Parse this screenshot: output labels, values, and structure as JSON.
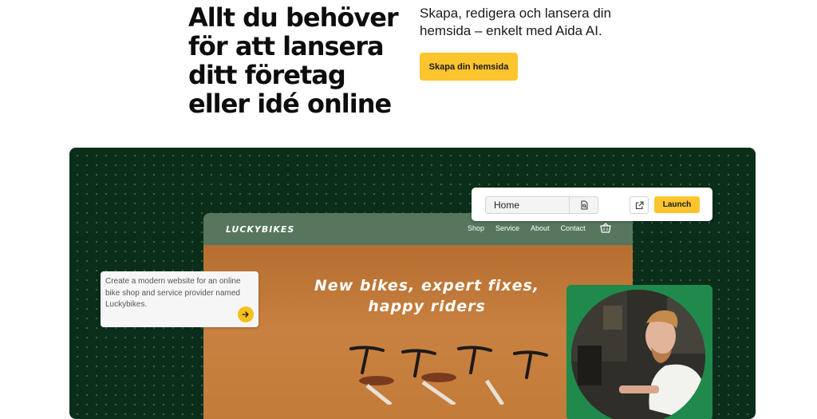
{
  "hero": {
    "title": "Allt du behöver för att lansera ditt företag eller idé online",
    "subtitle": "Skapa, redigera och lansera din hemsida – enkelt med Aida AI.",
    "cta_label": "Skapa din hemsida"
  },
  "toolbar": {
    "page_select_value": "Home",
    "launch_label": "Launch"
  },
  "mock_site": {
    "logo": "LUCKYBIKES",
    "nav": [
      "Shop",
      "Service",
      "About",
      "Contact"
    ],
    "headline": "New bikes, expert fixes, happy riders"
  },
  "prompt": {
    "text": "Create a modern website for an online bike shop and service provider named Luckybikes."
  },
  "colors": {
    "accent_yellow": "#fcc52e",
    "showcase_bg": "#0b2e1b",
    "mock_nav_green": "#56765d",
    "photo_card_green": "#1f8a4c"
  },
  "icons": {
    "page_settings": "page-search-icon",
    "open_external": "external-link-icon",
    "cart": "basket-icon",
    "send": "arrow-right-icon"
  }
}
